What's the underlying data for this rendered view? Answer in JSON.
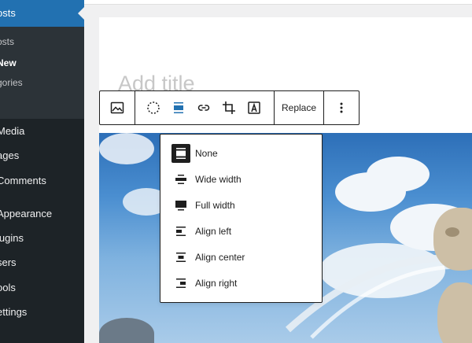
{
  "sidebar": {
    "active_label": "osts",
    "submenu": [
      {
        "label": "osts",
        "current": false
      },
      {
        "label": "New",
        "current": true
      },
      {
        "label": "gories",
        "current": false
      }
    ],
    "items": [
      {
        "label": "Media"
      },
      {
        "label": "ages"
      },
      {
        "label": "Comments"
      },
      {
        "label": "Appearance"
      },
      {
        "label": "lugins"
      },
      {
        "label": "sers"
      },
      {
        "label": "ools"
      },
      {
        "label": "ettings"
      }
    ]
  },
  "editor": {
    "title_placeholder": "Add title"
  },
  "toolbar": {
    "replace_label": "Replace",
    "icons": [
      "image-icon",
      "duotone-icon",
      "align-icon",
      "link-icon",
      "crop-icon",
      "text-over-image-icon",
      "more-options-icon"
    ]
  },
  "alignment_menu": {
    "items": [
      {
        "label": "None",
        "icon": "align-none-icon",
        "selected": true
      },
      {
        "label": "Wide width",
        "icon": "align-wide-icon",
        "selected": false
      },
      {
        "label": "Full width",
        "icon": "align-full-icon",
        "selected": false
      },
      {
        "label": "Align left",
        "icon": "align-left-icon",
        "selected": false
      },
      {
        "label": "Align center",
        "icon": "align-center-icon",
        "selected": false
      },
      {
        "label": "Align right",
        "icon": "align-right-icon",
        "selected": false
      }
    ]
  },
  "colors": {
    "sidebar_bg": "#1d2327",
    "sidebar_active": "#2271b1",
    "accent": "#2271b1",
    "text": "#1e1e1e"
  }
}
